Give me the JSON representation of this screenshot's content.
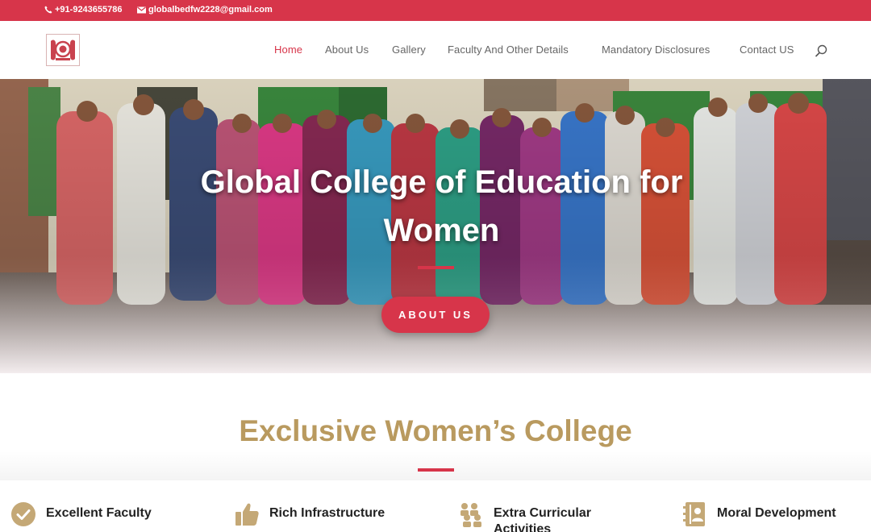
{
  "topbar": {
    "phone": "+91-9243655786",
    "email": "globalbedfw2228@gmail.com"
  },
  "header": {
    "logo_alt": "college-logo",
    "nav": [
      {
        "label": "Home",
        "active": true
      },
      {
        "label": "About Us",
        "active": false
      },
      {
        "label": "Gallery",
        "active": false
      },
      {
        "label": "Faculty And Other Details",
        "active": false
      },
      {
        "label": "Mandatory Disclosures",
        "active": false
      },
      {
        "label": "Contact US",
        "active": false
      }
    ],
    "search_icon": "search-icon"
  },
  "hero": {
    "title": "Global College of Education for Women",
    "button_label": "ABOUT US"
  },
  "section": {
    "title": "Exclusive Women’s College"
  },
  "features": [
    {
      "label": "Excellent Faculty",
      "icon": "checkmark-circle-icon"
    },
    {
      "label": "Rich Infrastructure",
      "icon": "thumbs-up-icon"
    },
    {
      "label": "Extra Curricular Activities",
      "icon": "group-people-icon"
    },
    {
      "label": "Moral Development",
      "icon": "address-book-icon"
    }
  ],
  "colors": {
    "accent": "#d7354a",
    "heading_gold": "#b99a5f",
    "icon_gold": "#c4a876"
  }
}
